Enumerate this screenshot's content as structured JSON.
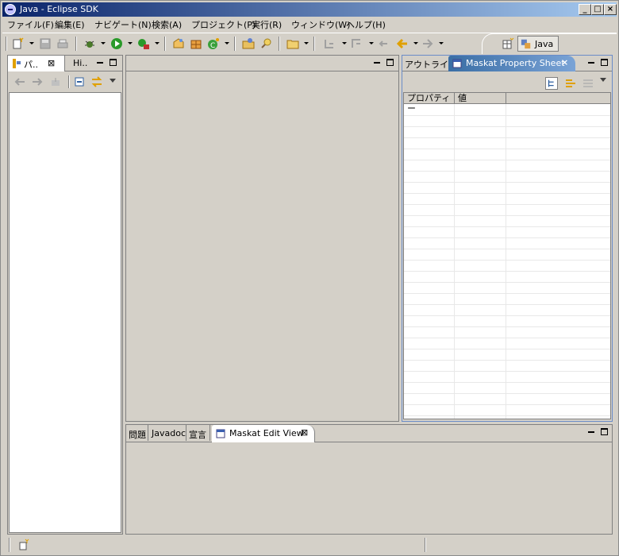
{
  "window": {
    "title": "Java - Eclipse SDK"
  },
  "menu": {
    "items": [
      "ファイル(F)",
      "編集(E)",
      "ナビゲート(N)",
      "検索(A)",
      "プロジェクト(P)",
      "実行(R)",
      "ウィンドウ(W)",
      "ヘルプ(H)"
    ]
  },
  "perspective": {
    "label": "Java"
  },
  "left_view": {
    "tabs": [
      "パ..",
      "Hi.."
    ]
  },
  "right_view": {
    "tabs": [
      "アウトライン",
      "Maskat Property Sheet"
    ],
    "columns": [
      "プロパティー",
      "値"
    ]
  },
  "bottom_view": {
    "tabs": [
      "問題",
      "Javadoc",
      "宣言",
      "Maskat Edit View"
    ]
  }
}
